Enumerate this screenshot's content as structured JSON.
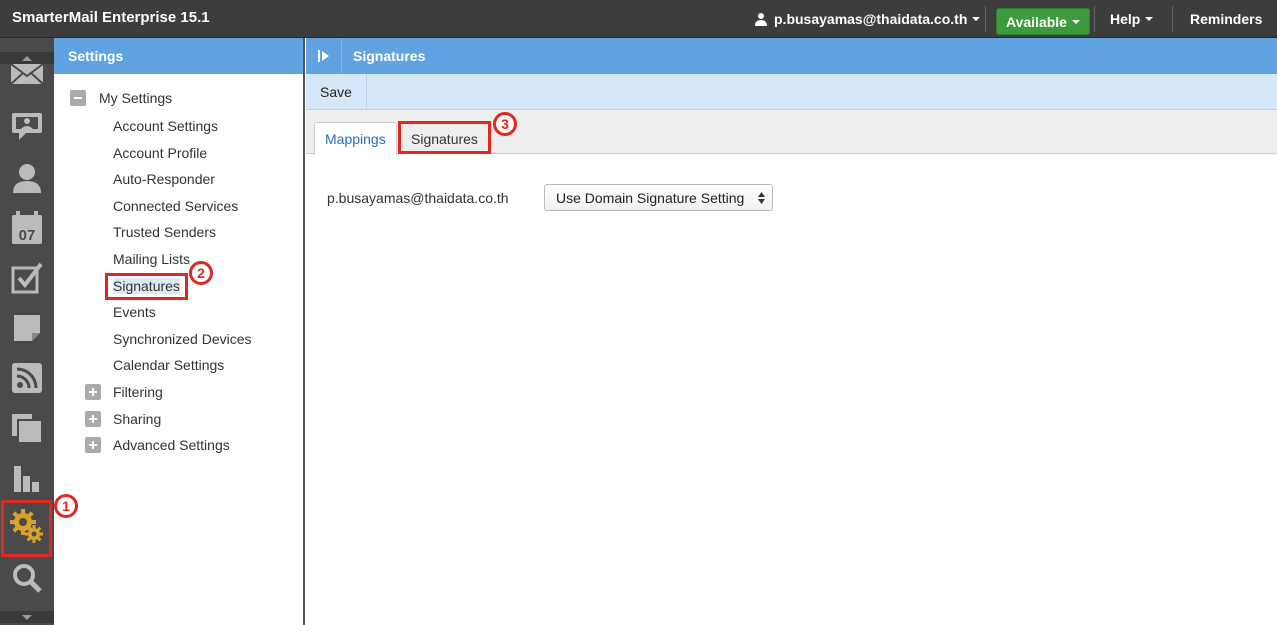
{
  "app": {
    "title": "SmarterMail Enterprise 15.1"
  },
  "topbar": {
    "user": "p.busayamas@thaidata.co.th",
    "status": "Available",
    "help": "Help",
    "reminders": "Reminders",
    "status_color": "#3c9b3c"
  },
  "iconbar": {
    "icons": [
      "mail-icon",
      "chat-icon",
      "contacts-icon",
      "calendar-icon",
      "tasks-icon",
      "notes-icon",
      "rss-icon",
      "files-icon",
      "reports-icon",
      "settings-icon",
      "search-icon"
    ],
    "calendar_day": "07"
  },
  "settings_panel": {
    "title": "Settings",
    "my_settings": "My Settings",
    "items": [
      "Account Settings",
      "Account Profile",
      "Auto-Responder",
      "Connected Services",
      "Trusted Senders",
      "Mailing Lists",
      "Signatures",
      "Events",
      "Synchronized Devices",
      "Calendar Settings"
    ],
    "groups": [
      "Filtering",
      "Sharing",
      "Advanced Settings"
    ]
  },
  "main": {
    "title": "Signatures",
    "save_label": "Save",
    "tabs": [
      "Mappings",
      "Signatures"
    ],
    "mapping_email": "p.busayamas@thaidata.co.th",
    "mapping_value": "Use Domain Signature Setting"
  },
  "annotations": {
    "step1": "1",
    "step2": "2",
    "step3": "3",
    "color": "#e0281e"
  },
  "colors": {
    "header_blue": "#5fa3e0",
    "toolbar_blue": "#d6e8f8",
    "settings_gear": "#d9a32a"
  }
}
